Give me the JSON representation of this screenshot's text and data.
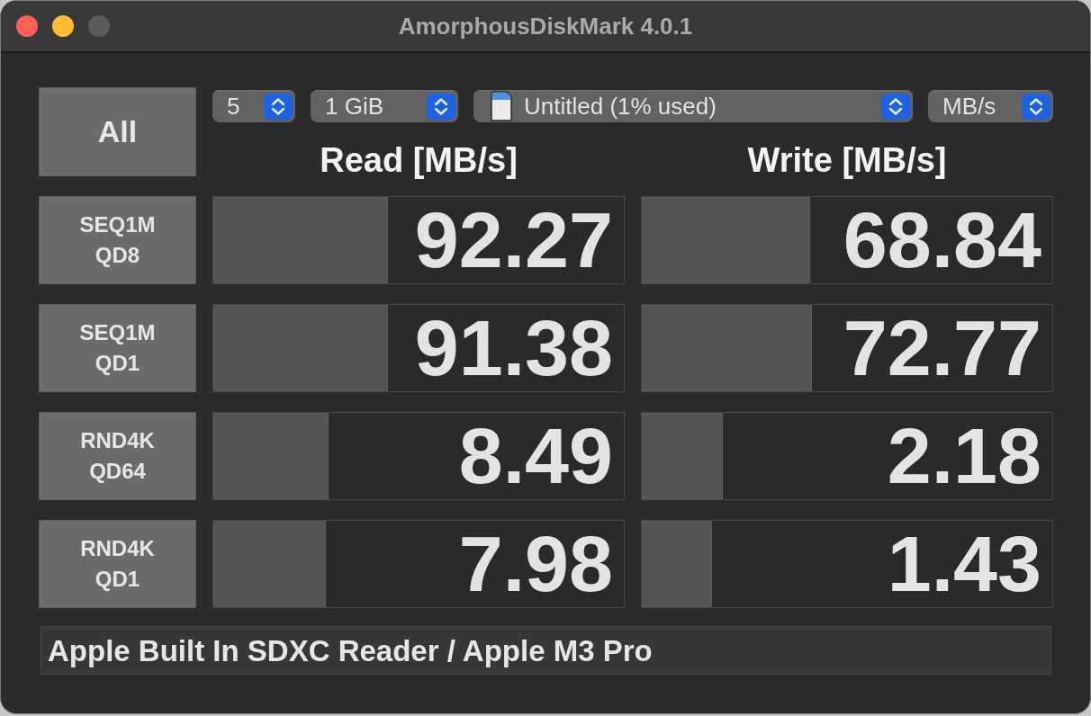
{
  "window": {
    "title": "AmorphousDiskMark 4.0.1",
    "traffic_lights": [
      {
        "kind": "close",
        "disabled": false
      },
      {
        "kind": "minimize",
        "disabled": false
      },
      {
        "kind": "zoom",
        "disabled": true
      }
    ]
  },
  "all_button": {
    "label": "All"
  },
  "selectors": [
    {
      "kind": "count",
      "value": "5"
    },
    {
      "kind": "size",
      "value": "1 GiB"
    },
    {
      "kind": "drive",
      "value": "Untitled (1% used)"
    },
    {
      "kind": "unit",
      "value": "MB/s"
    }
  ],
  "columns": [
    {
      "heading": "Read [MB/s]"
    },
    {
      "heading": "Write [MB/s]"
    }
  ],
  "tests": [
    {
      "name": "SEQ1M",
      "queue": "QD8",
      "read": {
        "value": "92.27",
        "level": 0.425
      },
      "write": {
        "value": "68.84",
        "level": 0.41
      }
    },
    {
      "name": "SEQ1M",
      "queue": "QD1",
      "read": {
        "value": "91.38",
        "level": 0.425
      },
      "write": {
        "value": "72.77",
        "level": 0.415
      }
    },
    {
      "name": "RND4K",
      "queue": "QD64",
      "read": {
        "value": "8.49",
        "level": 0.28
      },
      "write": {
        "value": "2.18",
        "level": 0.197
      }
    },
    {
      "name": "RND4K",
      "queue": "QD1",
      "read": {
        "value": "7.98",
        "level": 0.275
      },
      "write": {
        "value": "1.43",
        "level": 0.171
      }
    }
  ],
  "status_bar": {
    "text": "Apple Built In SDXC Reader / Apple M3 Pro"
  }
}
